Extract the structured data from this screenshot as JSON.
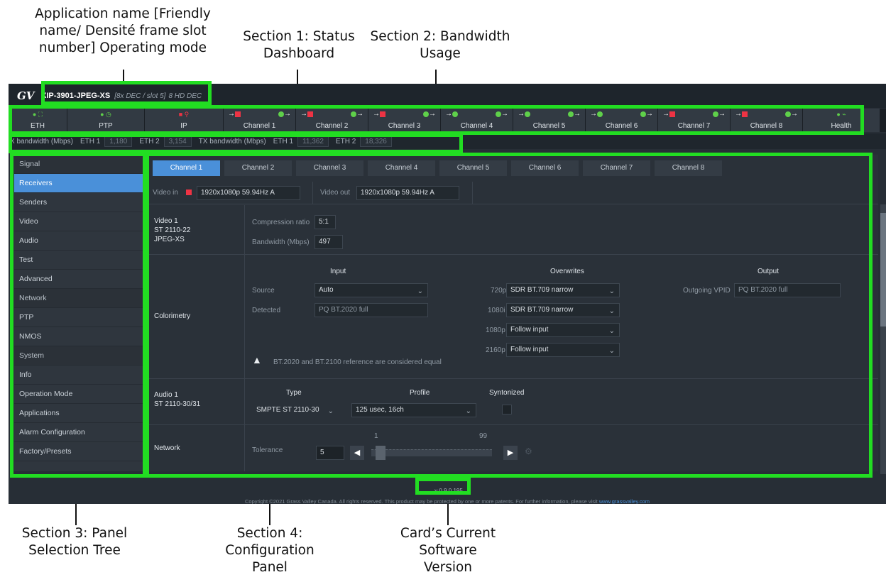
{
  "callouts": {
    "app_name": "Application name [Friendly name/ Densité frame slot number] Operating mode",
    "section1": "Section 1: Status Dashboard",
    "section2": "Section 2: Bandwidth Usage",
    "section3": "Section 3: Panel Selection Tree",
    "section4": "Section 4: Configuration Panel",
    "version_callout": "Card’s Current Software Version"
  },
  "titlebar": {
    "logo": "GV",
    "app_name": "XIP-3901-JPEG-XS",
    "slot_info": "[8x DEC / slot 5]",
    "mode": "8 HD DEC"
  },
  "status_tiles": [
    {
      "label": "ETH",
      "icons": "● ⛶"
    },
    {
      "label": "PTP",
      "icons": "● ◷"
    },
    {
      "label": "IP",
      "icons": "■ ⚲"
    },
    {
      "label": "Channel 1"
    },
    {
      "label": "Channel 2"
    },
    {
      "label": "Channel 3"
    },
    {
      "label": "Channel 4"
    },
    {
      "label": "Channel 5"
    },
    {
      "label": "Channel 6"
    },
    {
      "label": "Channel 7"
    },
    {
      "label": "Channel 8"
    },
    {
      "label": "Health",
      "icons": "● ⌁"
    }
  ],
  "bandwidth": {
    "rx_label": "X bandwidth (Mbps)",
    "rx_eth1_label": "ETH 1",
    "rx_eth1": "1,180",
    "rx_eth2_label": "ETH 2",
    "rx_eth2": "3,154",
    "tx_label": "TX bandwidth (Mbps)",
    "tx_eth1_label": "ETH 1",
    "tx_eth1": "11,362",
    "tx_eth2_label": "ETH 2",
    "tx_eth2": "18,326"
  },
  "sidebar": [
    {
      "label": "Signal",
      "type": "section"
    },
    {
      "label": "Receivers",
      "active": true
    },
    {
      "label": "Senders"
    },
    {
      "label": "Video"
    },
    {
      "label": "Audio"
    },
    {
      "label": "Test"
    },
    {
      "label": "Advanced"
    },
    {
      "label": "Network",
      "type": "section"
    },
    {
      "label": "PTP"
    },
    {
      "label": "NMOS"
    },
    {
      "label": "System",
      "type": "section"
    },
    {
      "label": "Info"
    },
    {
      "label": "Operation Mode"
    },
    {
      "label": "Applications"
    },
    {
      "label": "Alarm Configuration"
    },
    {
      "label": "Factory/Presets"
    }
  ],
  "tabs": [
    "Channel 1",
    "Channel 2",
    "Channel 3",
    "Channel 4",
    "Channel 5",
    "Channel 6",
    "Channel 7",
    "Channel 8"
  ],
  "video_row": {
    "video_in_label": "Video in",
    "video_in": "1920x1080p 59.94Hz A",
    "video_out_label": "Video out",
    "video_out": "1920x1080p 59.94Hz A"
  },
  "video1": {
    "title": "Video 1",
    "standard": "ST 2110-22",
    "codec": "JPEG-XS",
    "compression_label": "Compression ratio",
    "compression": "5:1",
    "bandwidth_label": "Bandwidth (Mbps)",
    "bandwidth": "497"
  },
  "colorimetry": {
    "title": "Colorimetry",
    "input_head": "Input",
    "overwrites_head": "Overwrites",
    "output_head": "Output",
    "source_label": "Source",
    "source": "Auto",
    "detected_label": "Detected",
    "detected": "PQ BT.2020 full",
    "ow_720p_label": "720p",
    "ow_720p": "SDR BT.709 narrow",
    "ow_1080i_label": "1080i",
    "ow_1080i": "SDR BT.709 narrow",
    "ow_1080p_label": "1080p",
    "ow_1080p": "Follow input",
    "ow_2160p_label": "2160p",
    "ow_2160p": "Follow input",
    "vpid_label": "Outgoing VPID",
    "vpid": "PQ BT.2020 full",
    "note": "BT.2020 and BT.2100 reference are considered equal"
  },
  "audio1": {
    "title": "Audio 1",
    "standard": "ST 2110-30/31",
    "type_head": "Type",
    "profile_head": "Profile",
    "synt_head": "Syntonized",
    "type": "SMPTE ST 2110-30",
    "profile": "125 usec, 16ch"
  },
  "network": {
    "title": "Network",
    "tolerance_label": "Tolerance",
    "value": "5",
    "min": "1",
    "max": "99",
    "slider_fraction": 0.04
  },
  "footer": {
    "version": "v 0.9.0.195",
    "copyright": "Copyright ©2021 Grass Valley Canada. All rights reserved. This product may be protected by one or more patents. For further information, please visit ",
    "link": "www.grassvalley.com"
  },
  "colors": {
    "highlight": "#22dd22",
    "accent": "#4a90d9",
    "ok": "#5fd04a",
    "error": "#ee3344"
  }
}
